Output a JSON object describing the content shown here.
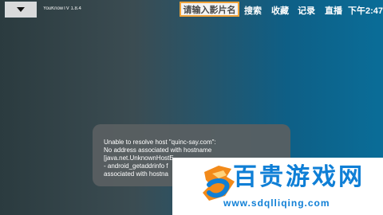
{
  "header": {
    "app_version": "YouKnowTV 1.8.4",
    "search_placeholder": "请输入影片名",
    "nav": {
      "search": "搜索",
      "favorites": "收藏",
      "records": "记录",
      "live": "直播"
    },
    "clock": "下午2:47"
  },
  "toast": {
    "lines": [
      "Unable to resolve host \"quinc-say.com\":",
      "No address associated with hostname",
      "[java.net.UnknownHostE",
      "- android_getaddrinfo f",
      "associated with hostna"
    ]
  },
  "watermark": {
    "title": "百贵游戏网",
    "url": "www.sdqlliqing.com"
  },
  "colors": {
    "accent_border": "#f0a33a",
    "watermark_blue": "#0f7fd6"
  }
}
